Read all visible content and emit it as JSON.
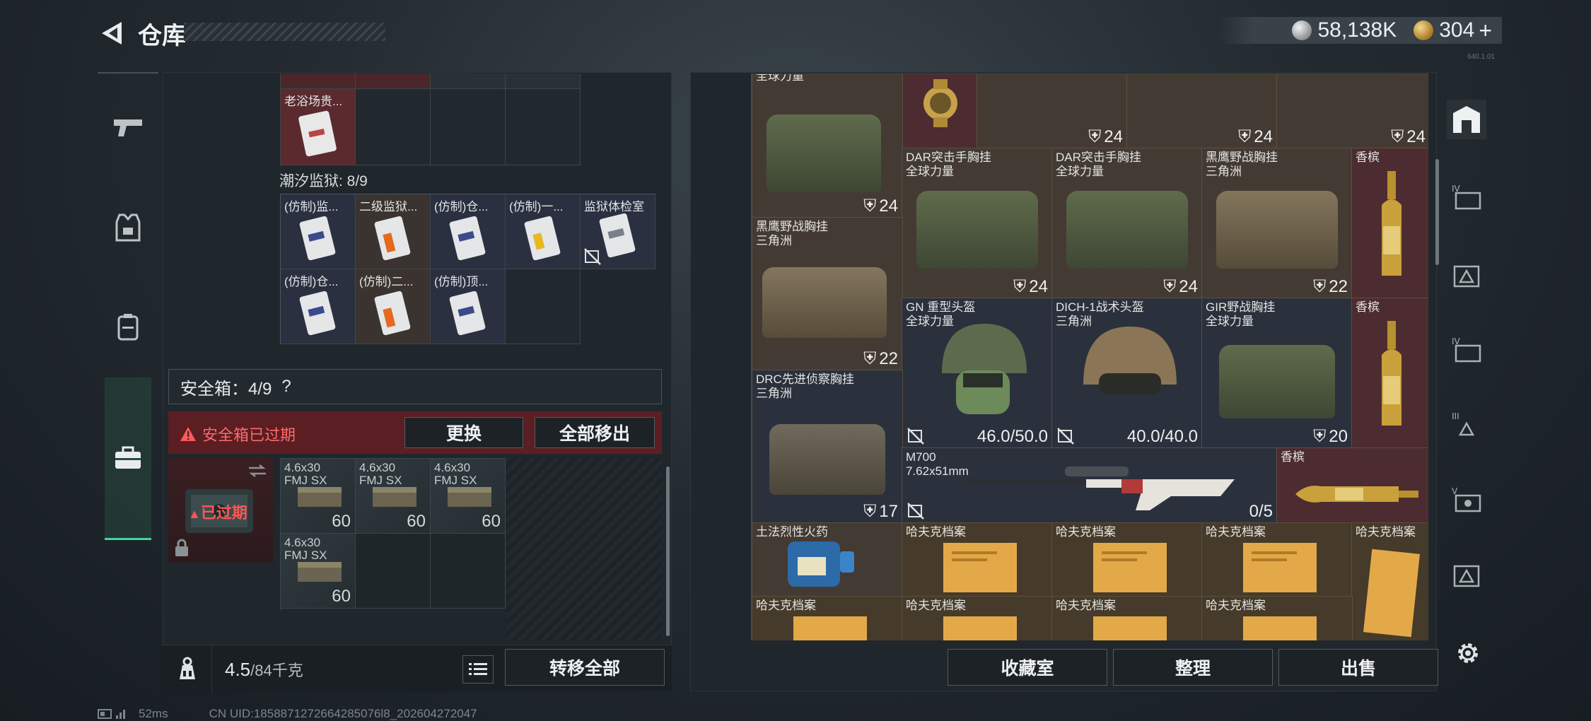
{
  "header": {
    "title": "仓库"
  },
  "currency": {
    "silver": "58,138K",
    "gold": "304"
  },
  "version": "640.1.01",
  "left": {
    "top_items": [
      {
        "name": "老浴场贵..."
      }
    ],
    "prison_label": "潮汐监狱: 8/9",
    "prison_items": [
      {
        "name": "(仿制)监..."
      },
      {
        "name": "二级监狱..."
      },
      {
        "name": "(仿制)仓..."
      },
      {
        "name": "(仿制)一..."
      },
      {
        "name": "监狱体检室"
      },
      {
        "name": "(仿制)仓..."
      },
      {
        "name": "(仿制)二..."
      },
      {
        "name": "(仿制)顶..."
      }
    ],
    "safe_label": "安全箱：4/9",
    "safe_help": "?",
    "expired_warning": "安全箱已过期",
    "replace_btn": "更换",
    "moveall_btn": "全部移出",
    "expired_badge": "已过期",
    "ammo": [
      {
        "name": "4.6x30 FMJ SX",
        "qty": "60"
      },
      {
        "name": "4.6x30 FMJ SX",
        "qty": "60"
      },
      {
        "name": "4.6x30 FMJ SX",
        "qty": "60"
      },
      {
        "name": "4.6x30 FMJ SX",
        "qty": "60"
      }
    ],
    "weight": "4.5",
    "weight_max": "/84千克",
    "transfer_btn": "转移全部"
  },
  "status": {
    "ping": "52ms",
    "uid": "CN UID:1858871272664285076l8_202604272047"
  },
  "right": {
    "cells": [
      {
        "name": "DAR突击手胸挂\n全球力量",
        "count": "24"
      },
      {
        "name": "DAR突击手胸挂\n全球力量",
        "count": "24"
      },
      {
        "name": "DAR突击手胸挂\n全球力量",
        "count": "24"
      },
      {
        "name": "黑鹰野战胸挂\n三角洲",
        "count": "22"
      },
      {
        "name": "香槟"
      },
      {
        "name": "黑鹰野战胸挂\n三角洲",
        "count": "22"
      },
      {
        "name": "GN 重型头盔\n全球力量",
        "durability": "46.0/50.0"
      },
      {
        "name": "DICH-1战术头盔\n三角洲",
        "durability": "40.0/40.0"
      },
      {
        "name": "GIR野战胸挂\n全球力量",
        "count": "20"
      },
      {
        "name": "香槟"
      },
      {
        "name": "DRC先进侦察胸挂\n三角洲",
        "count": "17"
      },
      {
        "name": "M700\n7.62x51mm",
        "ammo": "0/5"
      },
      {
        "name": "香槟"
      },
      {
        "name": "土法烈性火药"
      },
      {
        "name": "哈夫克档案"
      },
      {
        "name": "哈夫克档案"
      },
      {
        "name": "哈夫克档案"
      },
      {
        "name": "哈夫克档案"
      },
      {
        "name": "哈夫克档案"
      },
      {
        "name": "哈夫克档案"
      },
      {
        "name": "哈夫克档案"
      },
      {
        "name": "哈夫克档案"
      }
    ],
    "top_counts": [
      "24",
      "24",
      "24",
      "24"
    ],
    "top_name": "DAR突击手胸挂\n全球力量",
    "buttons": {
      "collection": "收藏室",
      "organize": "整理",
      "sell": "出售"
    }
  },
  "colors": {
    "accent": "#46d3a3",
    "warning": "#ff5555"
  }
}
